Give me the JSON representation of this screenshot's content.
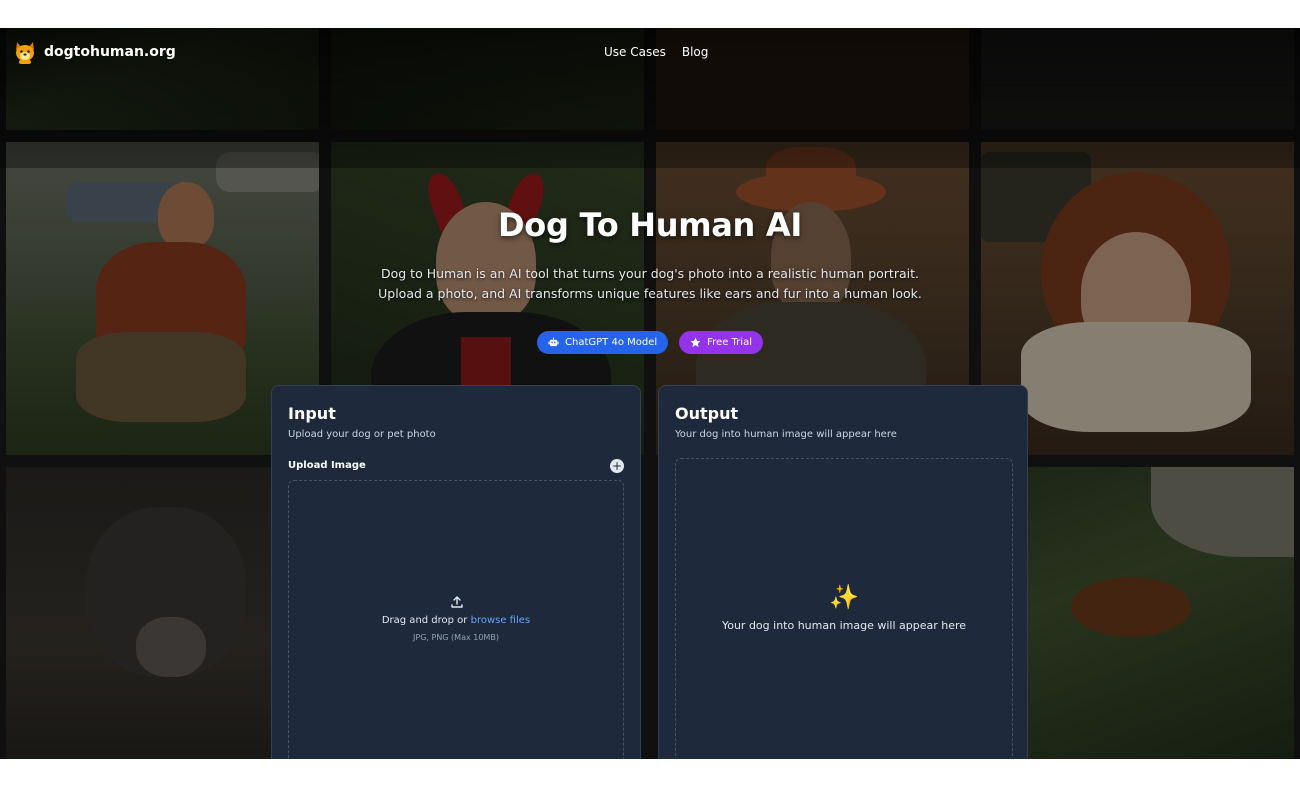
{
  "site": {
    "name": "dogtohuman.org"
  },
  "nav": {
    "items": [
      "Use Cases",
      "Blog"
    ]
  },
  "hero": {
    "title": "Dog To Human AI",
    "line1": "Dog to Human is an AI tool that turns your dog's photo into a realistic human portrait.",
    "line2": "Upload a photo, and AI transforms unique features like ears and fur into a human look.",
    "badge_model": "ChatGPT 4o Model",
    "badge_trial": "Free Trial"
  },
  "input_card": {
    "title": "Input",
    "subtitle": "Upload your dog or pet photo",
    "upload_label": "Upload Image",
    "plus": "+",
    "drop_text": "Drag and drop or",
    "browse": "browse files",
    "hint": "JPG, PNG (Max 10MB)"
  },
  "output_card": {
    "title": "Output",
    "subtitle": "Your dog into human image will appear here",
    "sparkle": "✨",
    "placeholder": "Your dog into human image will appear here"
  },
  "icons": {
    "logo": "dog-face-icon",
    "model": "robot-icon",
    "trial": "star-icon",
    "upload": "upload-icon",
    "add": "plus-icon"
  },
  "colors": {
    "card_bg": "#1e293b",
    "badge_blue": "#2563eb",
    "badge_purple": "#9333ea",
    "link": "#60a5fa"
  }
}
